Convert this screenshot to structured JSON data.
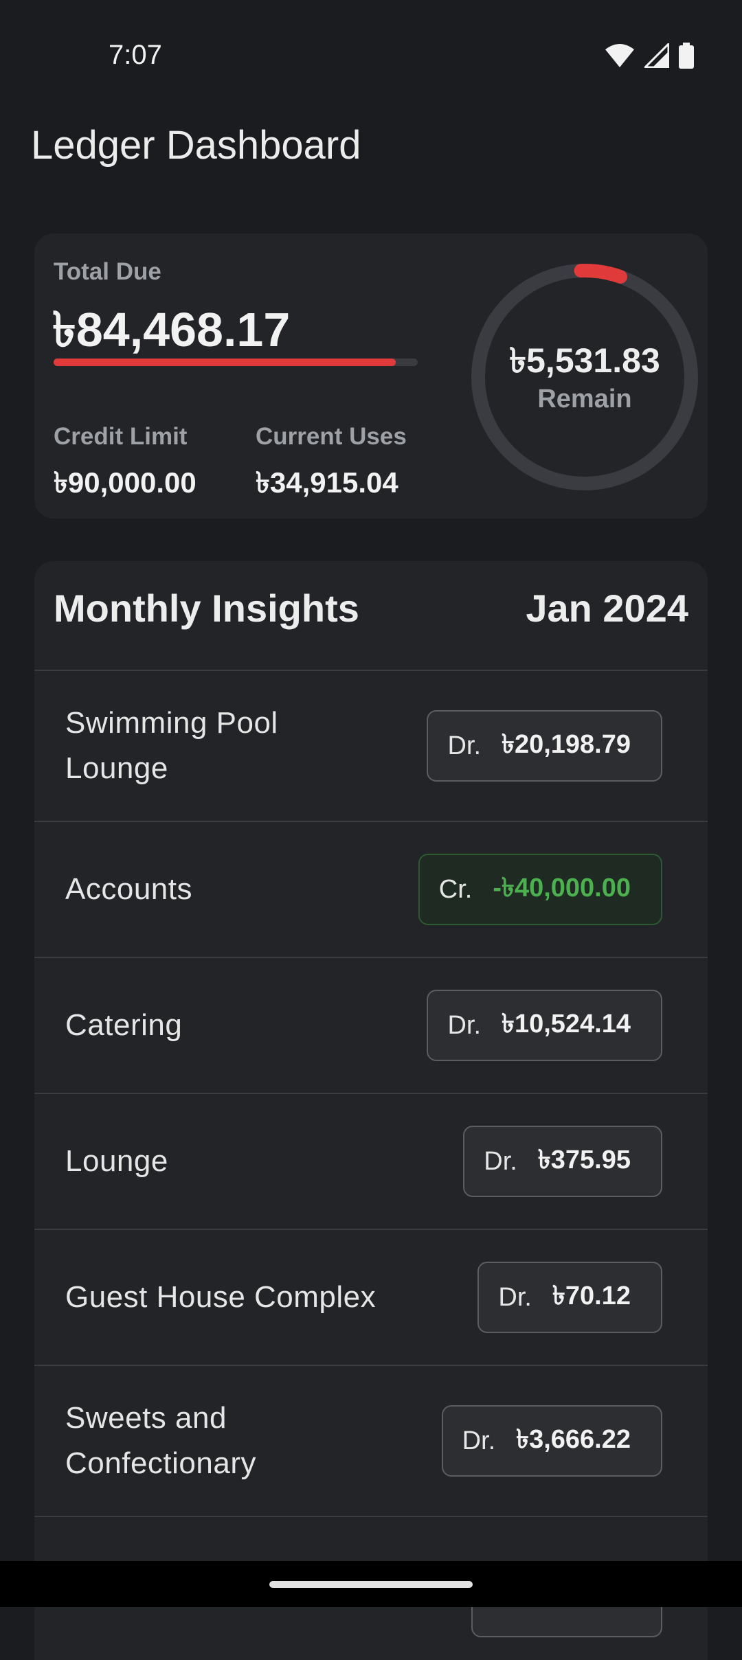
{
  "status_bar": {
    "time": "7:07"
  },
  "app": {
    "title": "Ledger Dashboard"
  },
  "summary": {
    "total_due_label": "Total Due",
    "total_due_value": "৳84,468.17",
    "due_progress": 0.94,
    "credit_limit_label": "Credit Limit",
    "credit_limit_value": "৳90,000.00",
    "current_uses_label": "Current Uses",
    "current_uses_value": "৳34,915.04",
    "remain_value": "৳5,531.83",
    "remain_label": "Remain",
    "remain_fraction": 0.06
  },
  "insights": {
    "title": "Monthly Insights",
    "month": "Jan 2024",
    "rows": [
      {
        "name": "Swimming Pool\nLounge",
        "type": "Dr.",
        "amount": "৳20,198.79"
      },
      {
        "name": "Accounts",
        "type": "Cr.",
        "amount": "-৳40,000.00"
      },
      {
        "name": "Catering",
        "type": "Dr.",
        "amount": "৳10,524.14"
      },
      {
        "name": "Lounge",
        "type": "Dr.",
        "amount": "৳375.95"
      },
      {
        "name": "Guest House Complex",
        "type": "Dr.",
        "amount": "৳70.12"
      },
      {
        "name": "Sweets and\nConfectionary",
        "type": "Dr.",
        "amount": "৳3,666.22"
      }
    ]
  },
  "colors": {
    "background": "#1b1c1f",
    "card": "#222428",
    "accent_red": "#e03a3a",
    "credit_green": "#4caf50"
  }
}
